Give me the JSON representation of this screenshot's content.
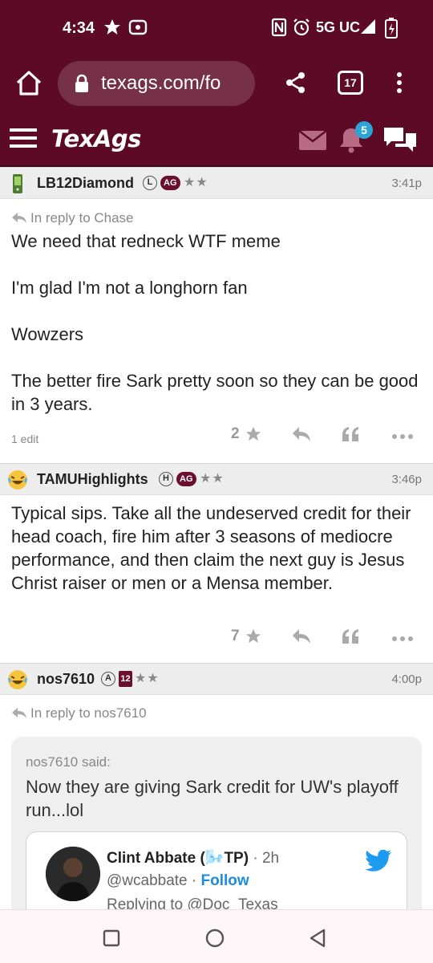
{
  "status_bar": {
    "time": "4:34",
    "network": "5G UC"
  },
  "browser": {
    "url": "texags.com/fo",
    "tab_count": "17"
  },
  "site": {
    "logo_text": "TexAgs",
    "notification_count": "5"
  },
  "posts": [
    {
      "username": "LB12Diamond",
      "rank": "L",
      "badge": "AG",
      "stars": "★★",
      "time": "3:41p",
      "reply_to": "In reply to Chase",
      "body": [
        "We need that redneck WTF meme",
        "I'm glad I'm not a longhorn fan",
        "Wowzers",
        "The better fire Sark pretty soon so they can be good in 3 years."
      ],
      "edit_note": "1 edit",
      "star_count": "2"
    },
    {
      "username": "TAMUHighlights",
      "rank": "H",
      "badge": "AG",
      "stars": "★★",
      "time": "3:46p",
      "body": [
        "Typical sips. Take all the undeserved credit for their head coach, fire him after 3 seasons of mediocre performance, and then claim the next guy is Jesus Christ raiser or men or a Mensa member."
      ],
      "star_count": "7"
    },
    {
      "username": "nos7610",
      "rank": "A",
      "badge": "12",
      "stars": "★★",
      "time": "4:00p",
      "reply_to": "In reply to nos7610",
      "quote": {
        "author": "nos7610 said:",
        "text": "Now they are giving Sark credit for UW's playoff run...lol",
        "tweet": {
          "name": "Clint Abbate (🌬️TP)",
          "time": "· 2h",
          "handle": "@wcabbate",
          "follow_label": "Follow",
          "replying": "Replying to @Doc_Texas"
        }
      }
    }
  ],
  "colors": {
    "brand": "#5c0a26",
    "accent_blue": "#2aa5d6",
    "follow_blue": "#1d8ce0",
    "twitter_blue": "#1d9bf0"
  }
}
